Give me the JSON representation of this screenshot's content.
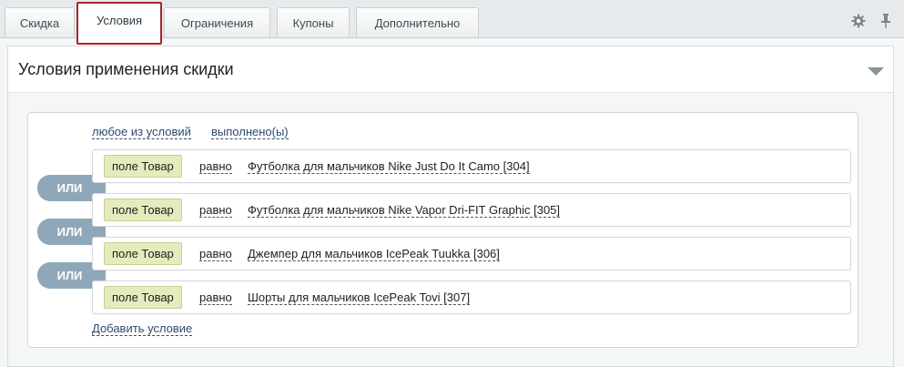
{
  "tabs": [
    {
      "label": "Скидка"
    },
    {
      "label": "Условия"
    },
    {
      "label": "Ограничения"
    },
    {
      "label": "Купоны"
    },
    {
      "label": "Дополнительно"
    }
  ],
  "section": {
    "title": "Условия применения скидки"
  },
  "logic": {
    "aggregator": "любое из условий",
    "state": "выполнено(ы)"
  },
  "or_label": "ИЛИ",
  "conditions": [
    {
      "field": "поле Товар",
      "operator": "равно",
      "value": "Футболка для мальчиков Nike Just Do It Camo [304]"
    },
    {
      "field": "поле Товар",
      "operator": "равно",
      "value": "Футболка для мальчиков Nike Vapor Dri-FIT Graphic [305]"
    },
    {
      "field": "поле Товар",
      "operator": "равно",
      "value": "Джемпер для мальчиков IcePeak Tuukka [306]"
    },
    {
      "field": "поле Товар",
      "operator": "равно",
      "value": "Шорты для мальчиков IcePeak Tovi [307]"
    }
  ],
  "add_condition": "Добавить условие",
  "colors": {
    "active_tab_border": "#a5252c",
    "field_bg": "#e5ebbc",
    "or_badge": "#8fa8b9",
    "link": "#2d4a6b"
  }
}
